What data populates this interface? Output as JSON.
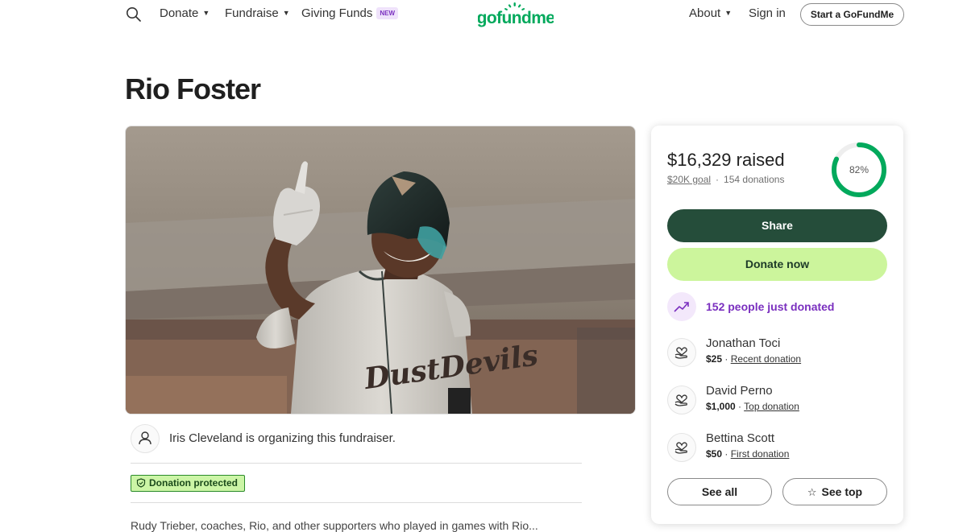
{
  "header": {
    "nav_left": [
      {
        "label": "Donate",
        "has_caret": true
      },
      {
        "label": "Fundraise",
        "has_caret": true
      },
      {
        "label": "Giving Funds",
        "badge": "NEW"
      }
    ],
    "logo_text": "gofundme",
    "nav_right": [
      {
        "label": "About",
        "has_caret": true
      },
      {
        "label": "Sign in"
      }
    ],
    "cta": "Start a GoFundMe"
  },
  "page": {
    "title": "Rio Foster",
    "hero_jersey_text": "DustDevils"
  },
  "organizer": {
    "text": "Iris Cleveland is organizing this fundraiser."
  },
  "protection_badge": "Donation protected",
  "story_preview": "Rudy Trieber, coaches, Rio, and other supporters who played in games with Rio...",
  "donation_card": {
    "raised": "$16,329 raised",
    "goal": "$20K goal",
    "donations": "154 donations",
    "progress_fraction": 0.82,
    "progress_label": "82%",
    "share_label": "Share",
    "donate_label": "Donate now",
    "trend_text": "152 people just donated",
    "donors": [
      {
        "name": "Jonathan Toci",
        "amount": "$25",
        "type": "Recent donation"
      },
      {
        "name": "David Perno",
        "amount": "$1,000",
        "type": "Top donation"
      },
      {
        "name": "Bettina Scott",
        "amount": "$50",
        "type": "First donation"
      }
    ],
    "see_all_label": "See all",
    "see_top_label": "See top"
  },
  "colors": {
    "brand_green": "#02a95c",
    "share_bg": "#254d3a",
    "donate_bg": "#ccf59c",
    "trend_purple": "#7a2fbf",
    "badge_green": "#ccf5a6"
  },
  "icons": {
    "search": "search-icon",
    "organizer": "person-icon",
    "shield": "shield-icon",
    "trend": "trending-up-icon",
    "donor": "heart-hand-icon",
    "star": "star-icon"
  }
}
